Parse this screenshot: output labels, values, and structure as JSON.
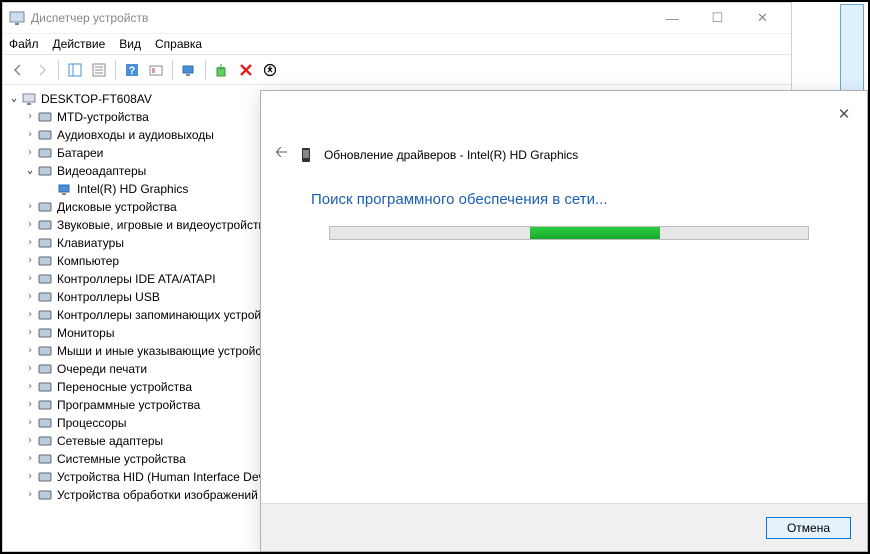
{
  "window": {
    "title": "Диспетчер устройств"
  },
  "menu": {
    "file": "Файл",
    "action": "Действие",
    "view": "Вид",
    "help": "Справка"
  },
  "tree": {
    "root": "DESKTOP-FT608AV",
    "items": [
      {
        "label": "MTD-устройства",
        "expanded": false
      },
      {
        "label": "Аудиовходы и аудиовыходы",
        "expanded": false
      },
      {
        "label": "Батареи",
        "expanded": false
      },
      {
        "label": "Видеоадаптеры",
        "expanded": true,
        "children": [
          {
            "label": "Intel(R) HD Graphics"
          }
        ]
      },
      {
        "label": "Дисковые устройства",
        "expanded": false
      },
      {
        "label": "Звуковые, игровые и видеоустройства",
        "expanded": false
      },
      {
        "label": "Клавиатуры",
        "expanded": false
      },
      {
        "label": "Компьютер",
        "expanded": false
      },
      {
        "label": "Контроллеры IDE ATA/ATAPI",
        "expanded": false
      },
      {
        "label": "Контроллеры USB",
        "expanded": false
      },
      {
        "label": "Контроллеры запоминающих устройств",
        "expanded": false
      },
      {
        "label": "Мониторы",
        "expanded": false
      },
      {
        "label": "Мыши и иные указывающие устройства",
        "expanded": false
      },
      {
        "label": "Очереди печати",
        "expanded": false
      },
      {
        "label": "Переносные устройства",
        "expanded": false
      },
      {
        "label": "Программные устройства",
        "expanded": false
      },
      {
        "label": "Процессоры",
        "expanded": false
      },
      {
        "label": "Сетевые адаптеры",
        "expanded": false
      },
      {
        "label": "Системные устройства",
        "expanded": false
      },
      {
        "label": "Устройства HID (Human Interface Devices)",
        "expanded": false
      },
      {
        "label": "Устройства обработки изображений",
        "expanded": false
      }
    ]
  },
  "dialog": {
    "title": "Обновление драйверов - Intel(R) HD Graphics",
    "status": "Поиск программного обеспечения в сети...",
    "cancel": "Отмена"
  }
}
